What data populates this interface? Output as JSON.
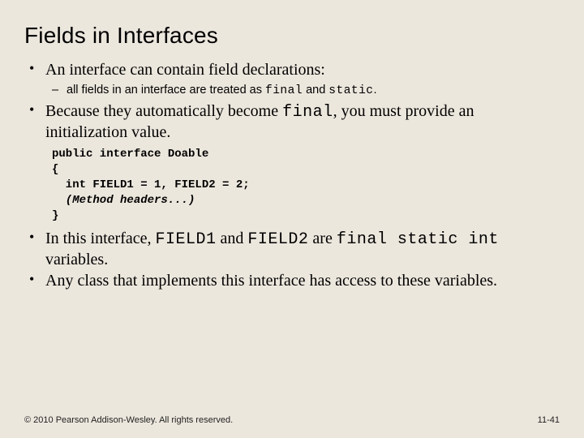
{
  "title": "Fields in Interfaces",
  "b1": {
    "text": "An interface can contain field declarations:",
    "sub_pre": "all fields in an interface are treated as ",
    "sub_c1": "final",
    "sub_mid": " and ",
    "sub_c2": "static",
    "sub_post": "."
  },
  "b2": {
    "pre": "Because they automatically become ",
    "c1": "final",
    "post": ", you must provide an initialization value."
  },
  "code": {
    "l1": "public interface Doable",
    "l2": "{",
    "l3": "  int FIELD1 = 1, FIELD2 = 2;",
    "l4": "  (Method headers...)",
    "l5": "}"
  },
  "b3": {
    "pre": "In this interface, ",
    "c1": "FIELD1",
    "mid1": " and ",
    "c2": "FIELD2",
    "mid2": " are ",
    "c3": "final static int",
    "post": " variables."
  },
  "b4": "Any class that implements this interface has access to these variables.",
  "footer": {
    "copyright": "© 2010 Pearson Addison-Wesley. All rights reserved.",
    "page": "11-41"
  }
}
